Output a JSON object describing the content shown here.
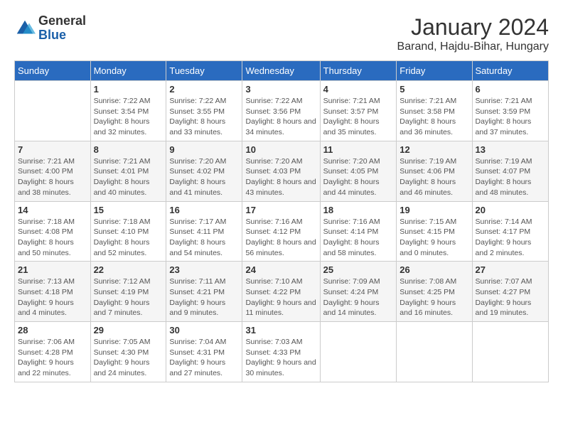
{
  "logo": {
    "general": "General",
    "blue": "Blue"
  },
  "header": {
    "month": "January 2024",
    "location": "Barand, Hajdu-Bihar, Hungary"
  },
  "weekdays": [
    "Sunday",
    "Monday",
    "Tuesday",
    "Wednesday",
    "Thursday",
    "Friday",
    "Saturday"
  ],
  "weeks": [
    [
      {
        "day": "",
        "sunrise": "",
        "sunset": "",
        "daylight": ""
      },
      {
        "day": "1",
        "sunrise": "Sunrise: 7:22 AM",
        "sunset": "Sunset: 3:54 PM",
        "daylight": "Daylight: 8 hours and 32 minutes."
      },
      {
        "day": "2",
        "sunrise": "Sunrise: 7:22 AM",
        "sunset": "Sunset: 3:55 PM",
        "daylight": "Daylight: 8 hours and 33 minutes."
      },
      {
        "day": "3",
        "sunrise": "Sunrise: 7:22 AM",
        "sunset": "Sunset: 3:56 PM",
        "daylight": "Daylight: 8 hours and 34 minutes."
      },
      {
        "day": "4",
        "sunrise": "Sunrise: 7:21 AM",
        "sunset": "Sunset: 3:57 PM",
        "daylight": "Daylight: 8 hours and 35 minutes."
      },
      {
        "day": "5",
        "sunrise": "Sunrise: 7:21 AM",
        "sunset": "Sunset: 3:58 PM",
        "daylight": "Daylight: 8 hours and 36 minutes."
      },
      {
        "day": "6",
        "sunrise": "Sunrise: 7:21 AM",
        "sunset": "Sunset: 3:59 PM",
        "daylight": "Daylight: 8 hours and 37 minutes."
      }
    ],
    [
      {
        "day": "7",
        "sunrise": "Sunrise: 7:21 AM",
        "sunset": "Sunset: 4:00 PM",
        "daylight": "Daylight: 8 hours and 38 minutes."
      },
      {
        "day": "8",
        "sunrise": "Sunrise: 7:21 AM",
        "sunset": "Sunset: 4:01 PM",
        "daylight": "Daylight: 8 hours and 40 minutes."
      },
      {
        "day": "9",
        "sunrise": "Sunrise: 7:20 AM",
        "sunset": "Sunset: 4:02 PM",
        "daylight": "Daylight: 8 hours and 41 minutes."
      },
      {
        "day": "10",
        "sunrise": "Sunrise: 7:20 AM",
        "sunset": "Sunset: 4:03 PM",
        "daylight": "Daylight: 8 hours and 43 minutes."
      },
      {
        "day": "11",
        "sunrise": "Sunrise: 7:20 AM",
        "sunset": "Sunset: 4:05 PM",
        "daylight": "Daylight: 8 hours and 44 minutes."
      },
      {
        "day": "12",
        "sunrise": "Sunrise: 7:19 AM",
        "sunset": "Sunset: 4:06 PM",
        "daylight": "Daylight: 8 hours and 46 minutes."
      },
      {
        "day": "13",
        "sunrise": "Sunrise: 7:19 AM",
        "sunset": "Sunset: 4:07 PM",
        "daylight": "Daylight: 8 hours and 48 minutes."
      }
    ],
    [
      {
        "day": "14",
        "sunrise": "Sunrise: 7:18 AM",
        "sunset": "Sunset: 4:08 PM",
        "daylight": "Daylight: 8 hours and 50 minutes."
      },
      {
        "day": "15",
        "sunrise": "Sunrise: 7:18 AM",
        "sunset": "Sunset: 4:10 PM",
        "daylight": "Daylight: 8 hours and 52 minutes."
      },
      {
        "day": "16",
        "sunrise": "Sunrise: 7:17 AM",
        "sunset": "Sunset: 4:11 PM",
        "daylight": "Daylight: 8 hours and 54 minutes."
      },
      {
        "day": "17",
        "sunrise": "Sunrise: 7:16 AM",
        "sunset": "Sunset: 4:12 PM",
        "daylight": "Daylight: 8 hours and 56 minutes."
      },
      {
        "day": "18",
        "sunrise": "Sunrise: 7:16 AM",
        "sunset": "Sunset: 4:14 PM",
        "daylight": "Daylight: 8 hours and 58 minutes."
      },
      {
        "day": "19",
        "sunrise": "Sunrise: 7:15 AM",
        "sunset": "Sunset: 4:15 PM",
        "daylight": "Daylight: 9 hours and 0 minutes."
      },
      {
        "day": "20",
        "sunrise": "Sunrise: 7:14 AM",
        "sunset": "Sunset: 4:17 PM",
        "daylight": "Daylight: 9 hours and 2 minutes."
      }
    ],
    [
      {
        "day": "21",
        "sunrise": "Sunrise: 7:13 AM",
        "sunset": "Sunset: 4:18 PM",
        "daylight": "Daylight: 9 hours and 4 minutes."
      },
      {
        "day": "22",
        "sunrise": "Sunrise: 7:12 AM",
        "sunset": "Sunset: 4:19 PM",
        "daylight": "Daylight: 9 hours and 7 minutes."
      },
      {
        "day": "23",
        "sunrise": "Sunrise: 7:11 AM",
        "sunset": "Sunset: 4:21 PM",
        "daylight": "Daylight: 9 hours and 9 minutes."
      },
      {
        "day": "24",
        "sunrise": "Sunrise: 7:10 AM",
        "sunset": "Sunset: 4:22 PM",
        "daylight": "Daylight: 9 hours and 11 minutes."
      },
      {
        "day": "25",
        "sunrise": "Sunrise: 7:09 AM",
        "sunset": "Sunset: 4:24 PM",
        "daylight": "Daylight: 9 hours and 14 minutes."
      },
      {
        "day": "26",
        "sunrise": "Sunrise: 7:08 AM",
        "sunset": "Sunset: 4:25 PM",
        "daylight": "Daylight: 9 hours and 16 minutes."
      },
      {
        "day": "27",
        "sunrise": "Sunrise: 7:07 AM",
        "sunset": "Sunset: 4:27 PM",
        "daylight": "Daylight: 9 hours and 19 minutes."
      }
    ],
    [
      {
        "day": "28",
        "sunrise": "Sunrise: 7:06 AM",
        "sunset": "Sunset: 4:28 PM",
        "daylight": "Daylight: 9 hours and 22 minutes."
      },
      {
        "day": "29",
        "sunrise": "Sunrise: 7:05 AM",
        "sunset": "Sunset: 4:30 PM",
        "daylight": "Daylight: 9 hours and 24 minutes."
      },
      {
        "day": "30",
        "sunrise": "Sunrise: 7:04 AM",
        "sunset": "Sunset: 4:31 PM",
        "daylight": "Daylight: 9 hours and 27 minutes."
      },
      {
        "day": "31",
        "sunrise": "Sunrise: 7:03 AM",
        "sunset": "Sunset: 4:33 PM",
        "daylight": "Daylight: 9 hours and 30 minutes."
      },
      {
        "day": "",
        "sunrise": "",
        "sunset": "",
        "daylight": ""
      },
      {
        "day": "",
        "sunrise": "",
        "sunset": "",
        "daylight": ""
      },
      {
        "day": "",
        "sunrise": "",
        "sunset": "",
        "daylight": ""
      }
    ]
  ]
}
